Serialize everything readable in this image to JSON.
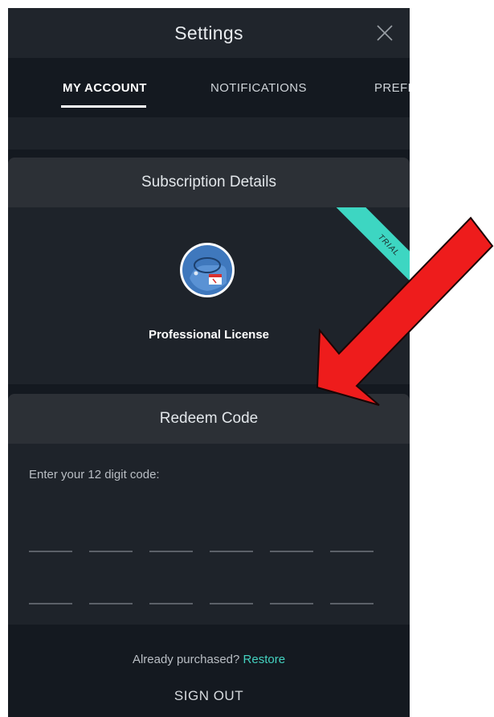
{
  "header": {
    "title": "Settings",
    "close_icon": "close-icon"
  },
  "tabs": [
    {
      "label": "MY ACCOUNT",
      "active": true
    },
    {
      "label": "NOTIFICATIONS",
      "active": false
    },
    {
      "label": "PREFE",
      "active": false
    }
  ],
  "subscription": {
    "heading": "Subscription Details",
    "ribbon": "TRIAL",
    "license_icon": "license-badge-icon",
    "license_name": "Professional License"
  },
  "redeem": {
    "heading": "Redeem Code",
    "prompt": "Enter your 12 digit code:",
    "digit_slots": 12
  },
  "footer": {
    "purchased_text": "Already purchased?",
    "restore_label": "Restore",
    "signout_label": "SIGN OUT"
  },
  "annotation": {
    "arrow_icon": "red-arrow-icon",
    "arrow_color": "#ee1c1c"
  },
  "colors": {
    "accent": "#44d2c0",
    "ribbon": "#3dd6c2",
    "background": "#141920"
  }
}
